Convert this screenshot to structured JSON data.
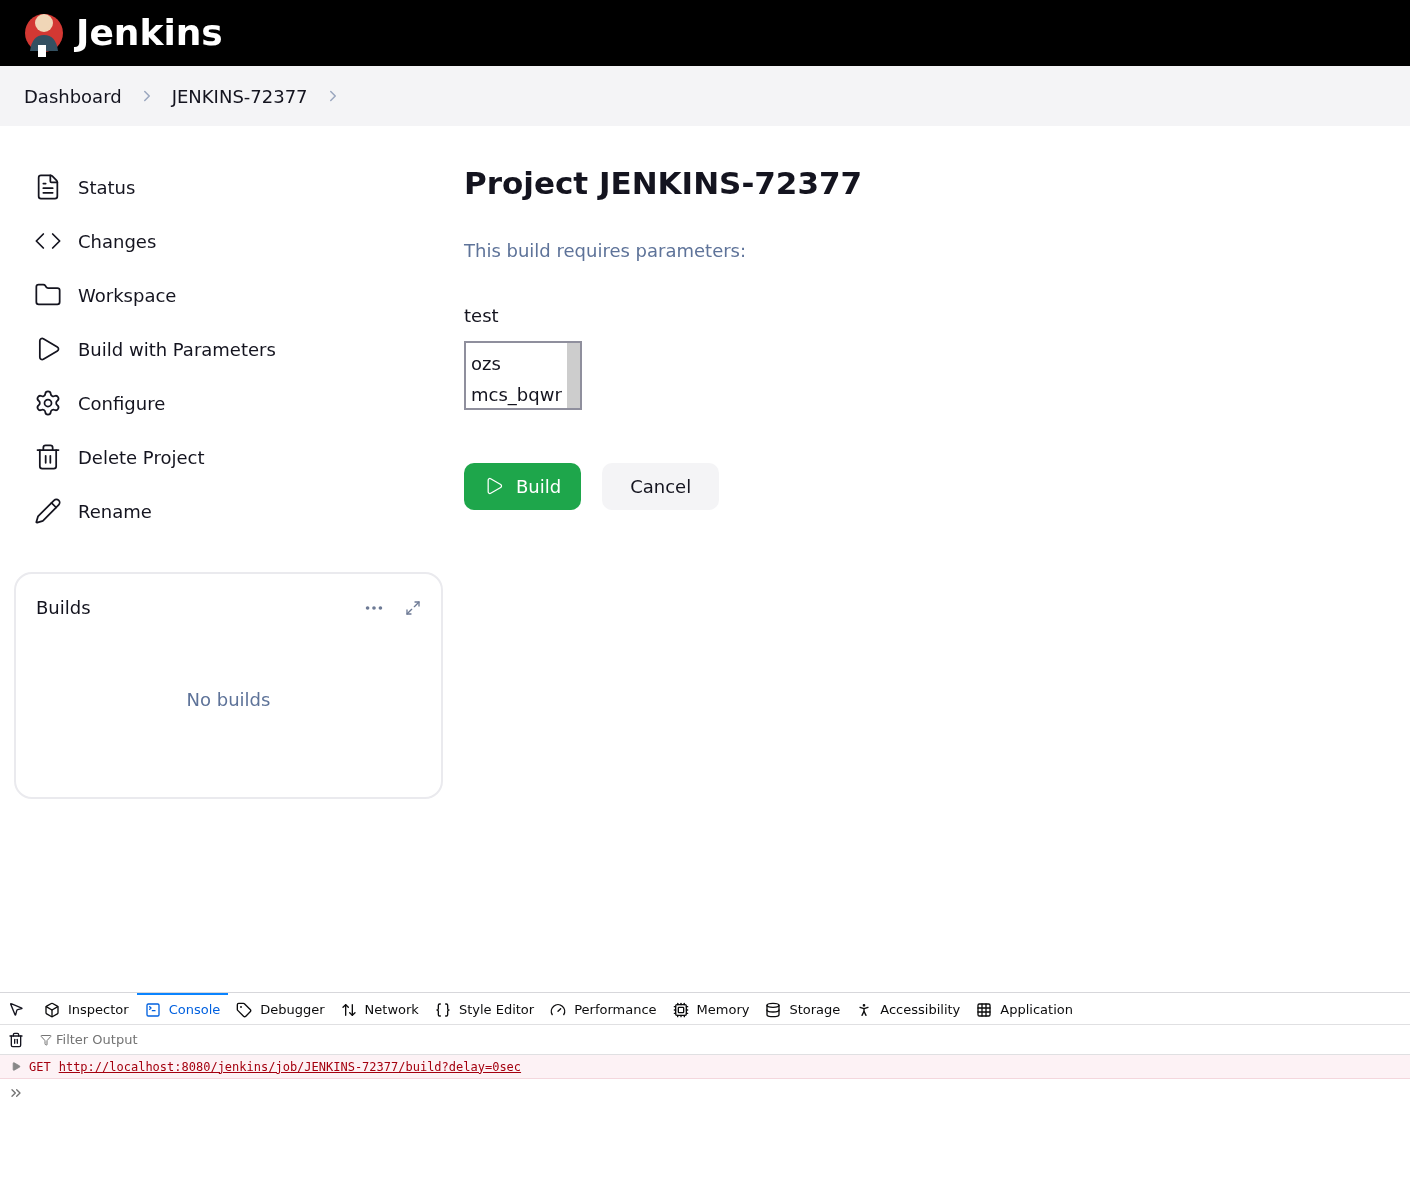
{
  "header": {
    "title": "Jenkins"
  },
  "breadcrumbs": [
    "Dashboard",
    "JENKINS-72377"
  ],
  "sidebar": {
    "items": [
      {
        "label": "Status"
      },
      {
        "label": "Changes"
      },
      {
        "label": "Workspace"
      },
      {
        "label": "Build with Parameters"
      },
      {
        "label": "Configure"
      },
      {
        "label": "Delete Project"
      },
      {
        "label": "Rename"
      }
    ]
  },
  "builds": {
    "title": "Builds",
    "empty": "No builds"
  },
  "main": {
    "title": "Project JENKINS-72377",
    "description": "This build requires parameters:",
    "parameter": {
      "name": "test",
      "options": [
        "ozs",
        "mcs_bqwr"
      ]
    },
    "build_button": "Build",
    "cancel_button": "Cancel"
  },
  "devtools": {
    "tabs": [
      {
        "label": "Inspector",
        "selected": false
      },
      {
        "label": "Console",
        "selected": true
      },
      {
        "label": "Debugger",
        "selected": false
      },
      {
        "label": "Network",
        "selected": false
      },
      {
        "label": "Style Editor",
        "selected": false
      },
      {
        "label": "Performance",
        "selected": false
      },
      {
        "label": "Memory",
        "selected": false
      },
      {
        "label": "Storage",
        "selected": false
      },
      {
        "label": "Accessibility",
        "selected": false
      },
      {
        "label": "Application",
        "selected": false
      }
    ],
    "filter_placeholder": "Filter Output",
    "log": {
      "method": "GET",
      "url": "http://localhost:8080/jenkins/job/JENKINS-72377/build?delay=0sec"
    }
  }
}
